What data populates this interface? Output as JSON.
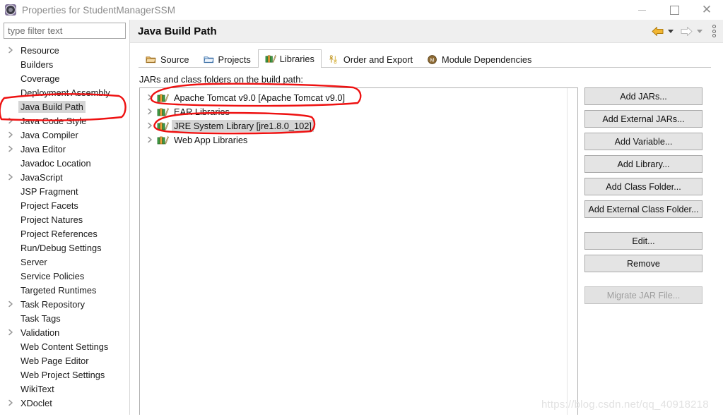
{
  "window": {
    "title": "Properties for StudentManagerSSM",
    "icon": "properties-gear-icon",
    "minimize_label": "–",
    "maximize_label": "□",
    "close_label": "✕"
  },
  "filter": {
    "placeholder": "type filter text",
    "value": ""
  },
  "sidebar": {
    "items": [
      {
        "label": "Resource",
        "expandable": true,
        "selected": false
      },
      {
        "label": "Builders",
        "expandable": false,
        "selected": false
      },
      {
        "label": "Coverage",
        "expandable": false,
        "selected": false
      },
      {
        "label": "Deployment Assembly",
        "expandable": false,
        "selected": false
      },
      {
        "label": "Java Build Path",
        "expandable": false,
        "selected": true
      },
      {
        "label": "Java Code Style",
        "expandable": true,
        "selected": false
      },
      {
        "label": "Java Compiler",
        "expandable": true,
        "selected": false
      },
      {
        "label": "Java Editor",
        "expandable": true,
        "selected": false
      },
      {
        "label": "Javadoc Location",
        "expandable": false,
        "selected": false
      },
      {
        "label": "JavaScript",
        "expandable": true,
        "selected": false
      },
      {
        "label": "JSP Fragment",
        "expandable": false,
        "selected": false
      },
      {
        "label": "Project Facets",
        "expandable": false,
        "selected": false
      },
      {
        "label": "Project Natures",
        "expandable": false,
        "selected": false
      },
      {
        "label": "Project References",
        "expandable": false,
        "selected": false
      },
      {
        "label": "Run/Debug Settings",
        "expandable": false,
        "selected": false
      },
      {
        "label": "Server",
        "expandable": false,
        "selected": false
      },
      {
        "label": "Service Policies",
        "expandable": false,
        "selected": false
      },
      {
        "label": "Targeted Runtimes",
        "expandable": false,
        "selected": false
      },
      {
        "label": "Task Repository",
        "expandable": true,
        "selected": false
      },
      {
        "label": "Task Tags",
        "expandable": false,
        "selected": false
      },
      {
        "label": "Validation",
        "expandable": true,
        "selected": false
      },
      {
        "label": "Web Content Settings",
        "expandable": false,
        "selected": false
      },
      {
        "label": "Web Page Editor",
        "expandable": false,
        "selected": false
      },
      {
        "label": "Web Project Settings",
        "expandable": false,
        "selected": false
      },
      {
        "label": "WikiText",
        "expandable": false,
        "selected": false
      },
      {
        "label": "XDoclet",
        "expandable": true,
        "selected": false
      }
    ]
  },
  "header": {
    "title": "Java Build Path",
    "back_icon": "back-arrow-icon",
    "back_caret_icon": "chevron-down-icon",
    "forward_icon": "forward-arrow-icon",
    "forward_caret_icon": "chevron-down-icon",
    "menu_icon": "vertical-dots-icon"
  },
  "tabs": [
    {
      "label": "Source",
      "icon": "source-folder-icon",
      "active": false
    },
    {
      "label": "Projects",
      "icon": "projects-folder-icon",
      "active": false
    },
    {
      "label": "Libraries",
      "icon": "libraries-books-icon",
      "active": true
    },
    {
      "label": "Order and Export",
      "icon": "order-export-arrows-icon",
      "active": false
    },
    {
      "label": "Module Dependencies",
      "icon": "module-dependencies-icon",
      "active": false
    }
  ],
  "main": {
    "list_label": "JARs and class folders on the build path:",
    "entries": [
      {
        "label": "Apache Tomcat v9.0 [Apache Tomcat v9.0]",
        "icon": "library-books-icon",
        "expandable": true,
        "selected": false
      },
      {
        "label": "EAR Libraries",
        "icon": "library-books-icon",
        "expandable": true,
        "selected": false
      },
      {
        "label": "JRE System Library [jre1.8.0_102]",
        "icon": "library-books-icon",
        "expandable": true,
        "selected": true
      },
      {
        "label": "Web App Libraries",
        "icon": "library-books-icon",
        "expandable": true,
        "selected": false
      }
    ]
  },
  "buttons": [
    {
      "label": "Add JARs...",
      "enabled": true,
      "gap_before": false
    },
    {
      "label": "Add External JARs...",
      "enabled": true,
      "gap_before": false
    },
    {
      "label": "Add Variable...",
      "enabled": true,
      "gap_before": false
    },
    {
      "label": "Add Library...",
      "enabled": true,
      "gap_before": false
    },
    {
      "label": "Add Class Folder...",
      "enabled": true,
      "gap_before": false
    },
    {
      "label": "Add External Class Folder...",
      "enabled": true,
      "gap_before": false
    },
    {
      "label": "Edit...",
      "enabled": true,
      "gap_before": true
    },
    {
      "label": "Remove",
      "enabled": true,
      "gap_before": false
    },
    {
      "label": "Migrate JAR File...",
      "enabled": false,
      "gap_before": true
    }
  ],
  "annotations": {
    "color": "#ee1111",
    "marks": [
      "ellipse-around-java-build-path",
      "ellipse-around-apache-tomcat-entry",
      "ellipse-around-jre-system-library-entry"
    ]
  },
  "watermark": {
    "text": "https://blog.csdn.net/qq_40918218"
  }
}
